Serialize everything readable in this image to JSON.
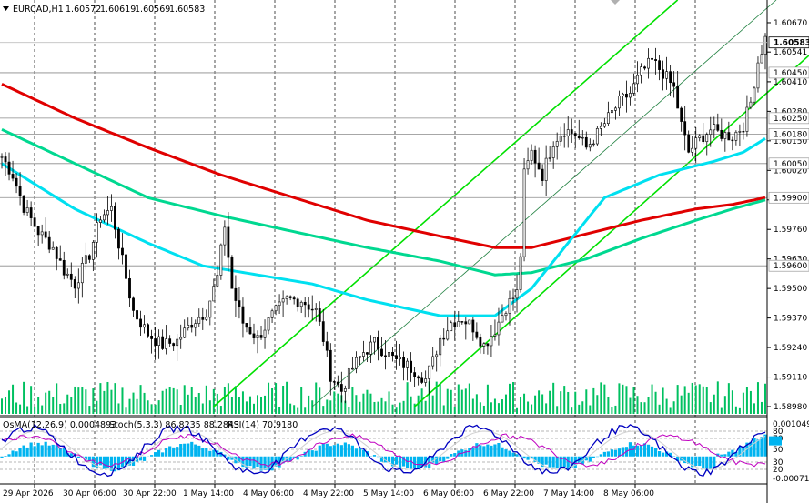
{
  "header": {
    "symbol_label": "EURCAD,H1",
    "open": "1.60572",
    "high": "1.60619",
    "low": "1.60569",
    "close": "1.60583"
  },
  "indicator_header": {
    "osma": "OsMA(12,26,9) 0.0004893",
    "stoch": "Stoch(5,3,3) 86.8235 88.2843",
    "rsi": "RSI(14) 70.9180"
  },
  "colors": {
    "background": "#ffffff",
    "candle": "#000000",
    "volume": "#00c060",
    "ma_red": "#e00000",
    "ma_teal": "#00d890",
    "ma_cyan": "#00e0f0",
    "channel": "#00e000",
    "osma_bars": "#00b4f0",
    "rsi_line": "#c000c0",
    "stoch_main": "#0000c0",
    "stoch_signal": "#d0d0d0",
    "level_line": "#8a8a8a",
    "grid": "#000000",
    "current_price_badge": "#ffffff"
  },
  "chart_data": {
    "type": "candlestick",
    "symbol": "EURCAD",
    "timeframe": "H1",
    "ylim": [
      1.5894,
      1.6077
    ],
    "y_ticks": [
      "1.60670",
      "1.60541",
      "1.60410",
      "1.60280",
      "1.60150",
      "1.60020",
      "1.59890",
      "1.59760",
      "1.59630",
      "1.59500",
      "1.59370",
      "1.59240",
      "1.59110",
      "1.58980"
    ],
    "x_labels": [
      "29 Apr 2026",
      "30 Apr 06:00",
      "30 Apr 22:00",
      "1 May 14:00",
      "4 May 06:00",
      "4 May 22:00",
      "5 May 14:00",
      "6 May 06:00",
      "6 May 22:00",
      "7 May 14:00",
      "8 May 06:00"
    ],
    "current_price": "1.60583",
    "price_levels": [
      "1.60450",
      "1.60250",
      "1.60180",
      "1.60050",
      "1.59900",
      "1.59600"
    ],
    "close_path": [
      [
        0,
        1.6008
      ],
      [
        3,
        1.6
      ],
      [
        6,
        1.5986
      ],
      [
        10,
        1.5975
      ],
      [
        14,
        1.5968
      ],
      [
        17,
        1.5958
      ],
      [
        20,
        1.5952
      ],
      [
        24,
        1.5965
      ],
      [
        27,
        1.5982
      ],
      [
        30,
        1.5985
      ],
      [
        33,
        1.5962
      ],
      [
        36,
        1.594
      ],
      [
        40,
        1.593
      ],
      [
        44,
        1.5925
      ],
      [
        48,
        1.5927
      ],
      [
        52,
        1.5935
      ],
      [
        56,
        1.594
      ],
      [
        59,
        1.5955
      ],
      [
        61,
        1.5978
      ],
      [
        63,
        1.595
      ],
      [
        66,
        1.5935
      ],
      [
        70,
        1.5928
      ],
      [
        74,
        1.5938
      ],
      [
        78,
        1.5945
      ],
      [
        82,
        1.5945
      ],
      [
        86,
        1.594
      ],
      [
        88,
        1.5928
      ],
      [
        90,
        1.5912
      ],
      [
        93,
        1.5905
      ],
      [
        96,
        1.5915
      ],
      [
        99,
        1.5922
      ],
      [
        102,
        1.5926
      ],
      [
        105,
        1.5922
      ],
      [
        108,
        1.5918
      ],
      [
        111,
        1.5916
      ],
      [
        114,
        1.5913
      ],
      [
        116,
        1.591
      ],
      [
        118,
        1.5918
      ],
      [
        120,
        1.5928
      ],
      [
        123,
        1.5935
      ],
      [
        126,
        1.5937
      ],
      [
        129,
        1.5933
      ],
      [
        132,
        1.5925
      ],
      [
        135,
        1.5932
      ],
      [
        138,
        1.5942
      ],
      [
        141,
        1.5948
      ],
      [
        142,
        1.5965
      ],
      [
        143,
        1.6
      ],
      [
        145,
        1.601
      ],
      [
        148,
        1.6
      ],
      [
        151,
        1.6015
      ],
      [
        154,
        1.602
      ],
      [
        157,
        1.6018
      ],
      [
        160,
        1.6012
      ],
      [
        163,
        1.6018
      ],
      [
        166,
        1.6025
      ],
      [
        169,
        1.6032
      ],
      [
        172,
        1.6036
      ],
      [
        175,
        1.6045
      ],
      [
        178,
        1.605
      ],
      [
        181,
        1.6045
      ],
      [
        184,
        1.6038
      ],
      [
        186,
        1.6022
      ],
      [
        188,
        1.601
      ],
      [
        191,
        1.6016
      ],
      [
        194,
        1.602
      ],
      [
        197,
        1.6018
      ],
      [
        200,
        1.6017
      ],
      [
        203,
        1.6022
      ],
      [
        205,
        1.6032
      ],
      [
        207,
        1.605
      ],
      [
        209,
        1.606
      ]
    ],
    "moving_averages": [
      {
        "color": "red",
        "points": [
          [
            0,
            1.604
          ],
          [
            20,
            1.6025
          ],
          [
            40,
            1.6012
          ],
          [
            60,
            1.6
          ],
          [
            80,
            1.599
          ],
          [
            100,
            1.598
          ],
          [
            120,
            1.5973
          ],
          [
            135,
            1.5968
          ],
          [
            145,
            1.5968
          ],
          [
            160,
            1.5974
          ],
          [
            175,
            1.598
          ],
          [
            190,
            1.5985
          ],
          [
            200,
            1.5987
          ],
          [
            209,
            1.599
          ]
        ]
      },
      {
        "color": "teal",
        "points": [
          [
            0,
            1.602
          ],
          [
            20,
            1.6005
          ],
          [
            40,
            1.599
          ],
          [
            60,
            1.5982
          ],
          [
            80,
            1.5975
          ],
          [
            100,
            1.5968
          ],
          [
            120,
            1.5962
          ],
          [
            135,
            1.5956
          ],
          [
            145,
            1.5957
          ],
          [
            160,
            1.5963
          ],
          [
            175,
            1.5972
          ],
          [
            190,
            1.598
          ],
          [
            200,
            1.5985
          ],
          [
            209,
            1.5989
          ]
        ]
      },
      {
        "color": "cyan",
        "points": [
          [
            0,
            1.6005
          ],
          [
            20,
            1.5985
          ],
          [
            40,
            1.597
          ],
          [
            55,
            1.596
          ],
          [
            70,
            1.5956
          ],
          [
            85,
            1.5952
          ],
          [
            100,
            1.5945
          ],
          [
            120,
            1.5938
          ],
          [
            135,
            1.5938
          ],
          [
            145,
            1.595
          ],
          [
            155,
            1.597
          ],
          [
            165,
            1.599
          ],
          [
            180,
            1.6
          ],
          [
            195,
            1.6006
          ],
          [
            203,
            1.601
          ],
          [
            209,
            1.6016
          ]
        ]
      }
    ],
    "channel_lines": [
      {
        "from": [
          58,
          1.5898
        ],
        "to": [
          185,
          1.6077
        ]
      },
      {
        "from": [
          113,
          1.5898
        ],
        "to": [
          238,
          1.6077
        ]
      },
      {
        "from": [
          85,
          1.5898
        ],
        "to": [
          212,
          1.6077
        ]
      }
    ],
    "indicators": {
      "osma": {
        "params": "12,26,9",
        "value": 0.0004893,
        "ylim": [
          -0.00075,
          0.00105
        ]
      },
      "stochastic": {
        "params": "5,3,3",
        "main": 86.8235,
        "signal": 88.2843
      },
      "rsi": {
        "params": "14",
        "value": 70.918
      },
      "levels": [
        "80",
        "70",
        "50",
        "30",
        "20"
      ],
      "y_ticks": [
        "0.0010496",
        "80",
        "70",
        "50",
        "30",
        "20",
        "-0.0007127"
      ]
    }
  }
}
